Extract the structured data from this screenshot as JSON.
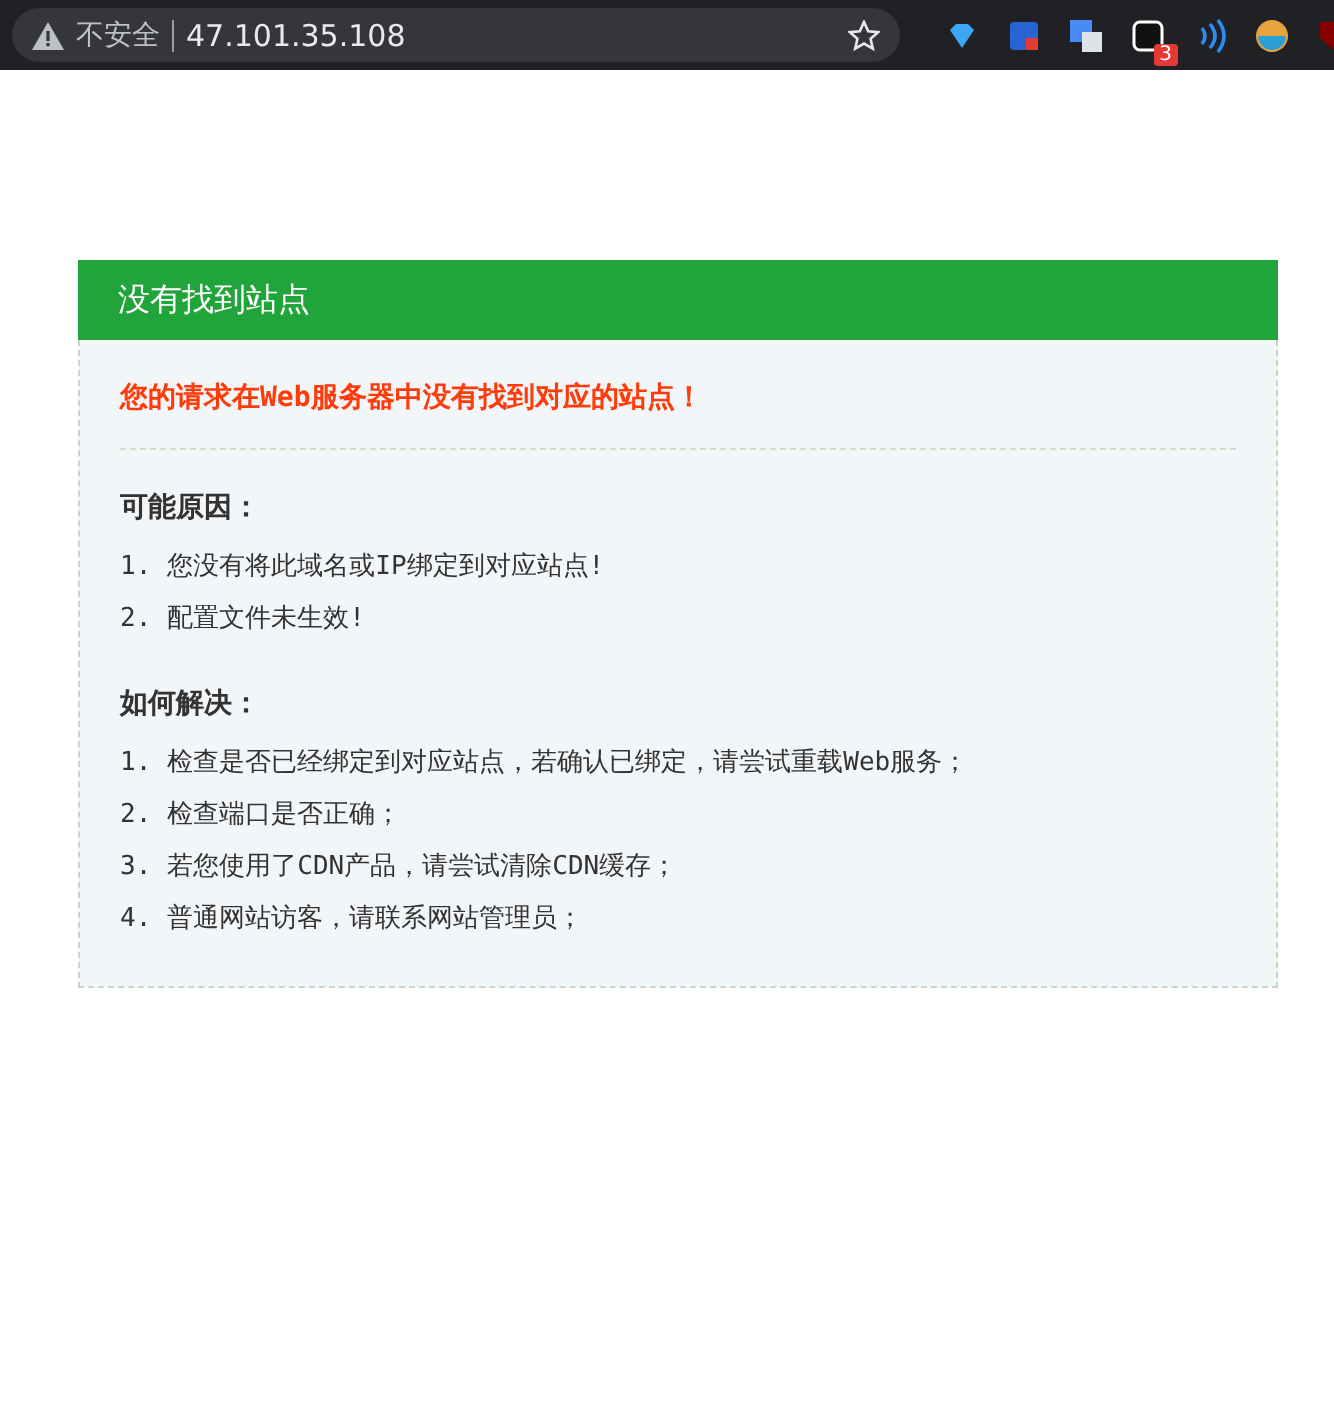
{
  "browser": {
    "security_label": "不安全",
    "url": "47.101.35.108",
    "extension_badge": "3"
  },
  "panel": {
    "title": "没有找到站点",
    "message": "您的请求在Web服务器中没有找到对应的站点！",
    "sections": [
      {
        "heading": "可能原因：",
        "items": [
          {
            "number": "1.",
            "text": "您没有将此域名或IP绑定到对应站点!"
          },
          {
            "number": "2.",
            "text": "配置文件未生效!"
          }
        ]
      },
      {
        "heading": "如何解决：",
        "items": [
          {
            "number": "1.",
            "text": "检查是否已经绑定到对应站点，若确认已绑定，请尝试重载Web服务；"
          },
          {
            "number": "2.",
            "text": "检查端口是否正确；"
          },
          {
            "number": "3.",
            "text": "若您使用了CDN产品，请尝试清除CDN缓存；"
          },
          {
            "number": "4.",
            "text": "普通网站访客，请联系网站管理员；"
          }
        ]
      }
    ]
  }
}
